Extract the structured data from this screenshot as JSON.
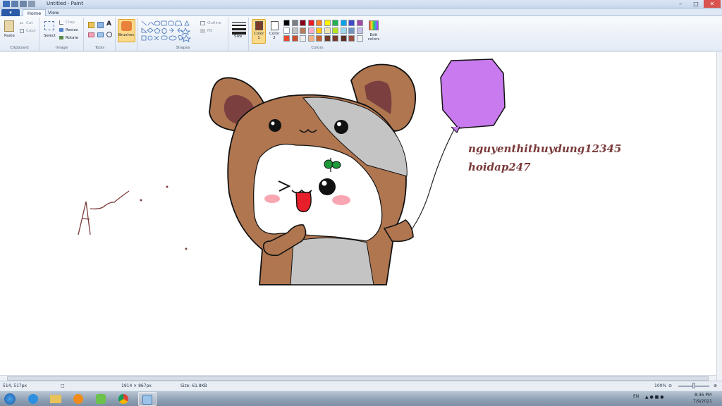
{
  "window": {
    "title": "Untitled - Paint"
  },
  "tabs": {
    "file": "▾",
    "home": "Home",
    "view": "View"
  },
  "ribbon": {
    "clipboard": {
      "label": "Clipboard",
      "paste": "Paste",
      "cut": "Cut",
      "copy": "Copy"
    },
    "image": {
      "label": "Image",
      "select": "Select",
      "crop": "Crop",
      "resize": "Resize",
      "rotate": "Rotate"
    },
    "tools": {
      "label": "Tools"
    },
    "brushes": {
      "label": "Brushes"
    },
    "shapes": {
      "label": "Shapes",
      "outline": "Outline",
      "fill": "Fill"
    },
    "size": {
      "label": "Size"
    },
    "colors": {
      "label": "Colors",
      "color1": "Color 1",
      "color2": "Color 2",
      "edit": "Edit colors"
    }
  },
  "palette": {
    "color1": "#7a3a2a",
    "color2": "#ffffff",
    "row1": [
      "#000000",
      "#7f7f7f",
      "#880015",
      "#ed1c24",
      "#ff7f27",
      "#fff200",
      "#22b14c",
      "#00a2e8",
      "#3f48cc",
      "#a349a4"
    ],
    "row2": [
      "#ffffff",
      "#c3c3c3",
      "#b97a57",
      "#ffaec9",
      "#ffc90e",
      "#efe4b0",
      "#b5e61d",
      "#99d9ea",
      "#7092be",
      "#c8bfe7"
    ],
    "row3": [
      "#e84a2c",
      "#c8502a",
      "#eeeeee",
      "#f4b183",
      "#c86432",
      "#6e3c28",
      "#7a3a2a",
      "#5a2e22",
      "#9b4c3c",
      "#f0f0f0"
    ]
  },
  "canvas": {
    "text_line1": "nguyenthithuydung12345",
    "text_line2": "hoidap247",
    "text_color": "#7a3a3a"
  },
  "status": {
    "cursor": "514, 517px",
    "selection": "",
    "dimensions": "1914 × 867px",
    "size": "Size: 61.8KB",
    "zoom": "100%"
  },
  "taskbar": {
    "lang": "EN",
    "time": "8:36 PM",
    "date": "7/9/2021"
  }
}
